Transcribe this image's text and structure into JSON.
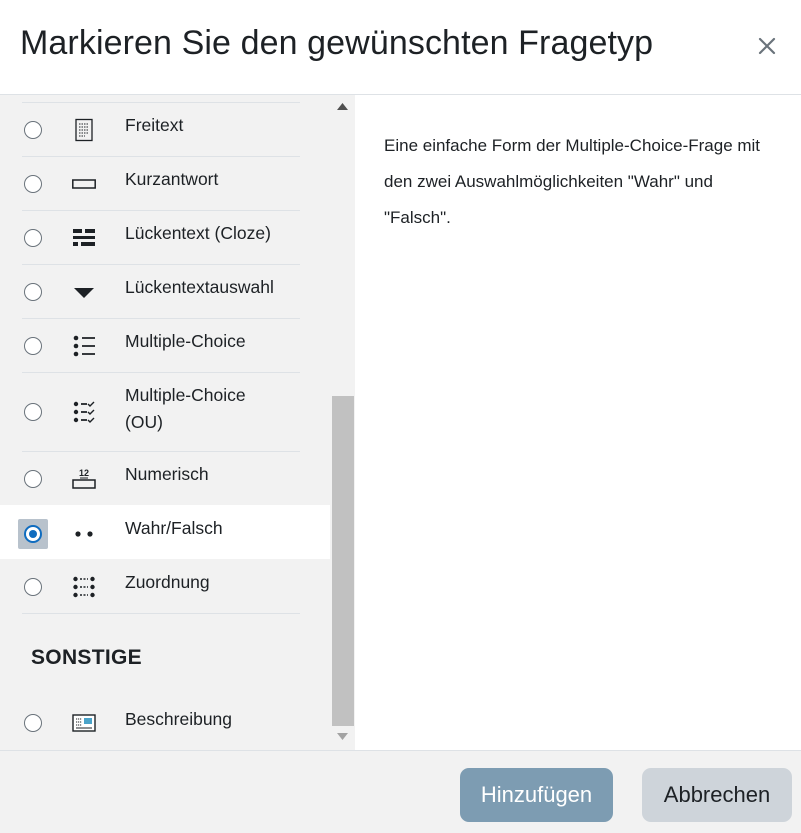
{
  "dialog": {
    "title": "Markieren Sie den gewünschten Fragetyp",
    "close_icon": "close-icon"
  },
  "options": [
    {
      "label": "Freitext",
      "icon": "essay-icon",
      "selected": false
    },
    {
      "label": "Kurzantwort",
      "icon": "short-answer-icon",
      "selected": false
    },
    {
      "label": "Lückentext (Cloze)",
      "icon": "cloze-icon",
      "selected": false
    },
    {
      "label": "Lückentextauswahl",
      "icon": "dropdown-triangle-icon",
      "selected": false
    },
    {
      "label": "Multiple-Choice",
      "icon": "multiple-choice-icon",
      "selected": false
    },
    {
      "label": "Multiple-Choice\n(OU)",
      "icon": "multiple-choice-ou-icon",
      "selected": false
    },
    {
      "label": "Numerisch",
      "icon": "numerical-icon",
      "selected": false
    },
    {
      "label": "Wahr/Falsch",
      "icon": "true-false-icon",
      "selected": true
    },
    {
      "label": "Zuordnung",
      "icon": "matching-icon",
      "selected": false
    }
  ],
  "other_section": {
    "heading": "SONSTIGE",
    "options": [
      {
        "label": "Beschreibung",
        "icon": "description-icon",
        "selected": false
      }
    ]
  },
  "description": "Eine einfache Form der Multiple-Choice-Frage mit den zwei Auswahlmöglichkeiten \"Wahr\" und \"Falsch\".",
  "footer": {
    "add_label": "Hinzufügen",
    "cancel_label": "Abbrechen"
  },
  "colors": {
    "accent": "#0f6cbf",
    "add_button": "#7d9cb2",
    "cancel_button": "#ced4da",
    "pane_background": "#f2f2f2"
  }
}
